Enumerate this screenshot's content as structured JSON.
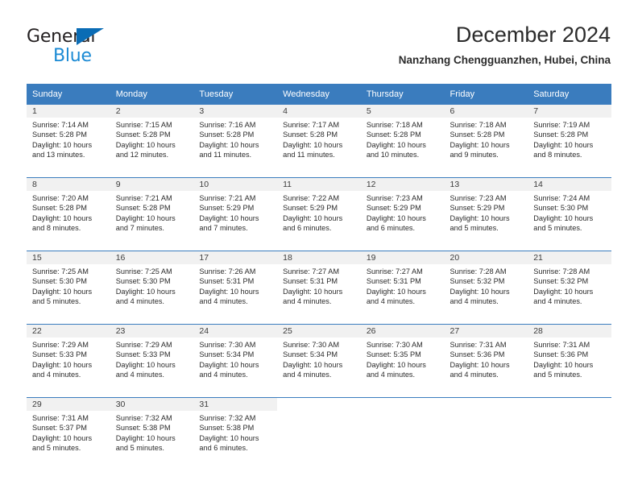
{
  "brand": {
    "name_part1": "General",
    "name_part2": "Blue",
    "triangle_color": "#0a6cb5",
    "blue_color": "#1b8ad4"
  },
  "header": {
    "title": "December 2024",
    "subtitle": "Nanzhang Chengguanzhen, Hubei, China"
  },
  "theme": {
    "header_bg": "#3a7cbe",
    "daynum_bg": "#f1f1f1",
    "text": "#2b2b2b"
  },
  "calendar": {
    "weekdays": [
      "Sunday",
      "Monday",
      "Tuesday",
      "Wednesday",
      "Thursday",
      "Friday",
      "Saturday"
    ],
    "weeks": [
      [
        {
          "day": "1",
          "sunrise": "Sunrise: 7:14 AM",
          "sunset": "Sunset: 5:28 PM",
          "daylight1": "Daylight: 10 hours",
          "daylight2": "and 13 minutes."
        },
        {
          "day": "2",
          "sunrise": "Sunrise: 7:15 AM",
          "sunset": "Sunset: 5:28 PM",
          "daylight1": "Daylight: 10 hours",
          "daylight2": "and 12 minutes."
        },
        {
          "day": "3",
          "sunrise": "Sunrise: 7:16 AM",
          "sunset": "Sunset: 5:28 PM",
          "daylight1": "Daylight: 10 hours",
          "daylight2": "and 11 minutes."
        },
        {
          "day": "4",
          "sunrise": "Sunrise: 7:17 AM",
          "sunset": "Sunset: 5:28 PM",
          "daylight1": "Daylight: 10 hours",
          "daylight2": "and 11 minutes."
        },
        {
          "day": "5",
          "sunrise": "Sunrise: 7:18 AM",
          "sunset": "Sunset: 5:28 PM",
          "daylight1": "Daylight: 10 hours",
          "daylight2": "and 10 minutes."
        },
        {
          "day": "6",
          "sunrise": "Sunrise: 7:18 AM",
          "sunset": "Sunset: 5:28 PM",
          "daylight1": "Daylight: 10 hours",
          "daylight2": "and 9 minutes."
        },
        {
          "day": "7",
          "sunrise": "Sunrise: 7:19 AM",
          "sunset": "Sunset: 5:28 PM",
          "daylight1": "Daylight: 10 hours",
          "daylight2": "and 8 minutes."
        }
      ],
      [
        {
          "day": "8",
          "sunrise": "Sunrise: 7:20 AM",
          "sunset": "Sunset: 5:28 PM",
          "daylight1": "Daylight: 10 hours",
          "daylight2": "and 8 minutes."
        },
        {
          "day": "9",
          "sunrise": "Sunrise: 7:21 AM",
          "sunset": "Sunset: 5:28 PM",
          "daylight1": "Daylight: 10 hours",
          "daylight2": "and 7 minutes."
        },
        {
          "day": "10",
          "sunrise": "Sunrise: 7:21 AM",
          "sunset": "Sunset: 5:29 PM",
          "daylight1": "Daylight: 10 hours",
          "daylight2": "and 7 minutes."
        },
        {
          "day": "11",
          "sunrise": "Sunrise: 7:22 AM",
          "sunset": "Sunset: 5:29 PM",
          "daylight1": "Daylight: 10 hours",
          "daylight2": "and 6 minutes."
        },
        {
          "day": "12",
          "sunrise": "Sunrise: 7:23 AM",
          "sunset": "Sunset: 5:29 PM",
          "daylight1": "Daylight: 10 hours",
          "daylight2": "and 6 minutes."
        },
        {
          "day": "13",
          "sunrise": "Sunrise: 7:23 AM",
          "sunset": "Sunset: 5:29 PM",
          "daylight1": "Daylight: 10 hours",
          "daylight2": "and 5 minutes."
        },
        {
          "day": "14",
          "sunrise": "Sunrise: 7:24 AM",
          "sunset": "Sunset: 5:30 PM",
          "daylight1": "Daylight: 10 hours",
          "daylight2": "and 5 minutes."
        }
      ],
      [
        {
          "day": "15",
          "sunrise": "Sunrise: 7:25 AM",
          "sunset": "Sunset: 5:30 PM",
          "daylight1": "Daylight: 10 hours",
          "daylight2": "and 5 minutes."
        },
        {
          "day": "16",
          "sunrise": "Sunrise: 7:25 AM",
          "sunset": "Sunset: 5:30 PM",
          "daylight1": "Daylight: 10 hours",
          "daylight2": "and 4 minutes."
        },
        {
          "day": "17",
          "sunrise": "Sunrise: 7:26 AM",
          "sunset": "Sunset: 5:31 PM",
          "daylight1": "Daylight: 10 hours",
          "daylight2": "and 4 minutes."
        },
        {
          "day": "18",
          "sunrise": "Sunrise: 7:27 AM",
          "sunset": "Sunset: 5:31 PM",
          "daylight1": "Daylight: 10 hours",
          "daylight2": "and 4 minutes."
        },
        {
          "day": "19",
          "sunrise": "Sunrise: 7:27 AM",
          "sunset": "Sunset: 5:31 PM",
          "daylight1": "Daylight: 10 hours",
          "daylight2": "and 4 minutes."
        },
        {
          "day": "20",
          "sunrise": "Sunrise: 7:28 AM",
          "sunset": "Sunset: 5:32 PM",
          "daylight1": "Daylight: 10 hours",
          "daylight2": "and 4 minutes."
        },
        {
          "day": "21",
          "sunrise": "Sunrise: 7:28 AM",
          "sunset": "Sunset: 5:32 PM",
          "daylight1": "Daylight: 10 hours",
          "daylight2": "and 4 minutes."
        }
      ],
      [
        {
          "day": "22",
          "sunrise": "Sunrise: 7:29 AM",
          "sunset": "Sunset: 5:33 PM",
          "daylight1": "Daylight: 10 hours",
          "daylight2": "and 4 minutes."
        },
        {
          "day": "23",
          "sunrise": "Sunrise: 7:29 AM",
          "sunset": "Sunset: 5:33 PM",
          "daylight1": "Daylight: 10 hours",
          "daylight2": "and 4 minutes."
        },
        {
          "day": "24",
          "sunrise": "Sunrise: 7:30 AM",
          "sunset": "Sunset: 5:34 PM",
          "daylight1": "Daylight: 10 hours",
          "daylight2": "and 4 minutes."
        },
        {
          "day": "25",
          "sunrise": "Sunrise: 7:30 AM",
          "sunset": "Sunset: 5:34 PM",
          "daylight1": "Daylight: 10 hours",
          "daylight2": "and 4 minutes."
        },
        {
          "day": "26",
          "sunrise": "Sunrise: 7:30 AM",
          "sunset": "Sunset: 5:35 PM",
          "daylight1": "Daylight: 10 hours",
          "daylight2": "and 4 minutes."
        },
        {
          "day": "27",
          "sunrise": "Sunrise: 7:31 AM",
          "sunset": "Sunset: 5:36 PM",
          "daylight1": "Daylight: 10 hours",
          "daylight2": "and 4 minutes."
        },
        {
          "day": "28",
          "sunrise": "Sunrise: 7:31 AM",
          "sunset": "Sunset: 5:36 PM",
          "daylight1": "Daylight: 10 hours",
          "daylight2": "and 5 minutes."
        }
      ],
      [
        {
          "day": "29",
          "sunrise": "Sunrise: 7:31 AM",
          "sunset": "Sunset: 5:37 PM",
          "daylight1": "Daylight: 10 hours",
          "daylight2": "and 5 minutes."
        },
        {
          "day": "30",
          "sunrise": "Sunrise: 7:32 AM",
          "sunset": "Sunset: 5:38 PM",
          "daylight1": "Daylight: 10 hours",
          "daylight2": "and 5 minutes."
        },
        {
          "day": "31",
          "sunrise": "Sunrise: 7:32 AM",
          "sunset": "Sunset: 5:38 PM",
          "daylight1": "Daylight: 10 hours",
          "daylight2": "and 6 minutes."
        },
        {
          "day": "",
          "sunrise": "",
          "sunset": "",
          "daylight1": "",
          "daylight2": ""
        },
        {
          "day": "",
          "sunrise": "",
          "sunset": "",
          "daylight1": "",
          "daylight2": ""
        },
        {
          "day": "",
          "sunrise": "",
          "sunset": "",
          "daylight1": "",
          "daylight2": ""
        },
        {
          "day": "",
          "sunrise": "",
          "sunset": "",
          "daylight1": "",
          "daylight2": ""
        }
      ]
    ]
  }
}
